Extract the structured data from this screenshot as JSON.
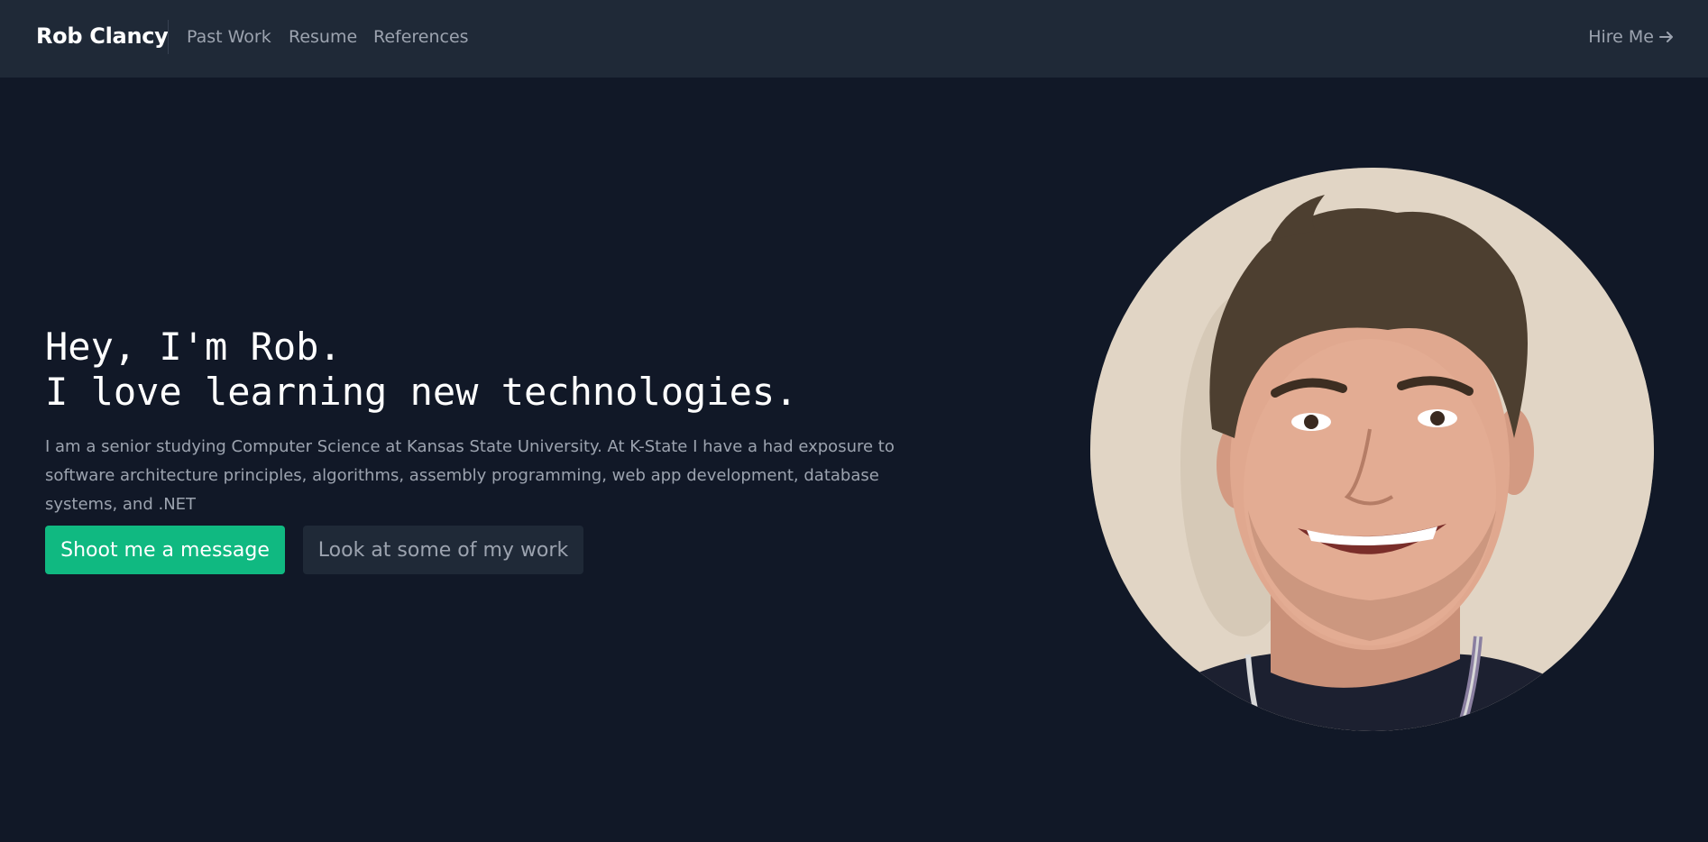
{
  "header": {
    "brand": "Rob Clancy",
    "links": [
      "Past Work",
      "Resume",
      "References"
    ],
    "cta": "Hire Me",
    "cta_icon": "arrow-right-icon"
  },
  "hero": {
    "title_line1": "Hey, I'm Rob.",
    "title_line2": "I love learning new technologies.",
    "description": "I am a senior studying Computer Science at Kansas State University. At K-State I have a had exposure to software architecture principles, algorithms, assembly programming, web app development, database systems, and .NET",
    "primary_button": "Shoot me a message",
    "secondary_button": "Look at some of my work"
  },
  "colors": {
    "background": "#111827",
    "nav_background": "#1f2937",
    "accent": "#10b981",
    "muted_text": "#9ca3af"
  }
}
